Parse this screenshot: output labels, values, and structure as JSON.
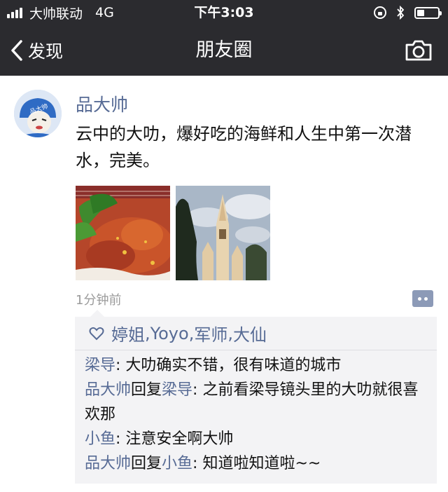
{
  "status_bar": {
    "carrier": "大帅联动",
    "network": "4G",
    "time": "下午3:03"
  },
  "nav": {
    "back_label": "发现",
    "title": "朋友圈"
  },
  "post": {
    "author": "品大帅",
    "avatar_text": "品大帅",
    "text": "云中的大叻，爆好吃的海鲜和人生中第一次潜水，完美。",
    "time": "1分钟前",
    "likes": [
      "婷姐",
      "Yoyo",
      "军师",
      "大仙"
    ],
    "like_separator": ", ",
    "comments": [
      {
        "author": "梁导",
        "reply_word": "",
        "reply_to": "",
        "text": ": 大叻确实不错，很有味道的城市"
      },
      {
        "author": "品大帅",
        "reply_word": "回复",
        "reply_to": "梁导",
        "text": ": 之前看梁导镜头里的大叻就很喜欢那"
      },
      {
        "author": "小鱼",
        "reply_word": "",
        "reply_to": "",
        "text": ": 注意安全啊大帅"
      },
      {
        "author": "品大帅",
        "reply_word": "回复",
        "reply_to": "小鱼",
        "text": ": 知道啦知道啦~~"
      }
    ]
  },
  "colors": {
    "header_bg": "#2b2b2f",
    "name_link": "#576b95",
    "comment_bg": "#f3f3f5",
    "timestamp": "#9b9b9b"
  },
  "icons": [
    "signal-icon",
    "lock-rotation-icon",
    "bluetooth-icon",
    "battery-icon",
    "back-chevron-icon",
    "camera-icon",
    "heart-icon",
    "comment-dots-icon"
  ]
}
